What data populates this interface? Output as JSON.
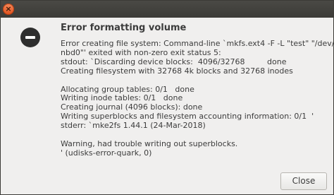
{
  "dialog": {
    "title": "Error formatting volume",
    "message_lines": [
      "Error creating file system: Command-line `mkfs.ext4 -F -L \"test\" \"/dev/",
      "nbd0\"' exited with non-zero exit status 5:",
      "stdout: `Discarding device blocks:  4096/32768         done",
      "Creating filesystem with 32768 4k blocks and 32768 inodes",
      "",
      "Allocating group tables: 0/1   done",
      "Writing inode tables: 0/1   done",
      "Creating journal (4096 blocks): done",
      "Writing superblocks and filesystem accounting information: 0/1  '",
      "stderr: `mke2fs 1.44.1 (24-Mar-2018)",
      "",
      "Warning, had trouble writing out superblocks.",
      "' (udisks-error-quark, 0)"
    ],
    "close_button_label": "Close"
  },
  "window": {
    "close_glyph": "×"
  },
  "icons": {
    "dialog_icon": "error-icon",
    "titlebar_close": "close-icon"
  },
  "colors": {
    "titlebar": "#3c3b37",
    "close_accent": "#e95420",
    "text": "#3c3c3c"
  }
}
